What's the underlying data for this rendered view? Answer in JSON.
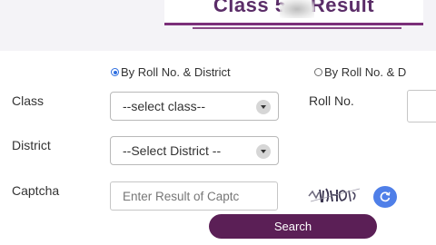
{
  "header": {
    "title": "Class 5    Result"
  },
  "search_mode": {
    "option_district": "By Roll No. & District",
    "option_other": "By Roll No. & D",
    "selected": "option_district"
  },
  "form": {
    "class_label": "Class",
    "class_value": "--select class--",
    "roll_label": "Roll No.",
    "roll_value": "",
    "district_label": "District",
    "district_value": "--Select District --",
    "captcha_label": "Captcha",
    "captcha_placeholder": "Enter Result of Captc"
  },
  "actions": {
    "search_label": "Search"
  },
  "icons": {
    "refresh": "refresh-icon",
    "dropdown": "chevron-down-icon"
  },
  "colors": {
    "brand": "#5b1f56",
    "title": "#5b2d68",
    "accent": "#4f7fe8"
  }
}
